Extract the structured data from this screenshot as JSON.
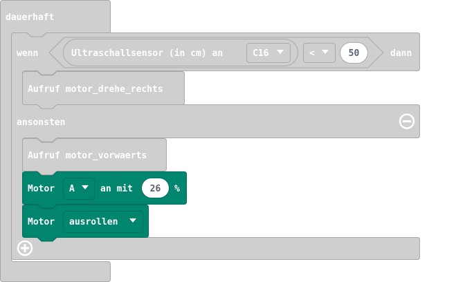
{
  "colors": {
    "block_grey": "#cfcfcf",
    "block_grey_border": "#a9a9a9",
    "block_grey_dark": "#bfbfbf",
    "motor_green": "#00856e",
    "motor_green_dark": "#006e5b",
    "text_white": "#ffffff",
    "value_text": "#575e75"
  },
  "forever_block": {
    "label": "dauerhaft"
  },
  "if_block": {
    "if_label": "wenn",
    "then_label": "dann",
    "else_label": "ansonsten",
    "remove_else_icon": "minus-circle-icon",
    "add_clause_icon": "plus-circle-icon",
    "condition": {
      "sensor_label": "Ultraschallsensor (in cm) an",
      "pin_value": "C16",
      "operator_value": "<",
      "compare_value": "50"
    }
  },
  "then_statements": [
    {
      "label": "Aufruf motor_drehe_rechts"
    }
  ],
  "else_statements": [
    {
      "label": "Aufruf motor_vorwaerts"
    },
    {
      "motor_label": "Motor",
      "motor_value": "A",
      "speed_label": "an mit",
      "speed_value": "26",
      "unit_label": "%"
    },
    {
      "motor_label": "Motor",
      "mode_value": "ausrollen"
    }
  ]
}
